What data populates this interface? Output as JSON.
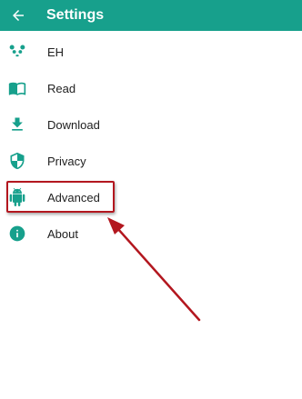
{
  "appbar": {
    "title": "Settings",
    "back_icon": "arrow-back-icon"
  },
  "menu": {
    "items": [
      {
        "label": "EH",
        "icon": "panda-icon"
      },
      {
        "label": "Read",
        "icon": "book-icon"
      },
      {
        "label": "Download",
        "icon": "download-icon"
      },
      {
        "label": "Privacy",
        "icon": "shield-icon"
      },
      {
        "label": "Advanced",
        "icon": "android-icon"
      },
      {
        "label": "About",
        "icon": "info-icon"
      }
    ]
  },
  "colors": {
    "accent": "#17a08c",
    "icon": "#17a08c",
    "annotation": "#b3171f"
  }
}
